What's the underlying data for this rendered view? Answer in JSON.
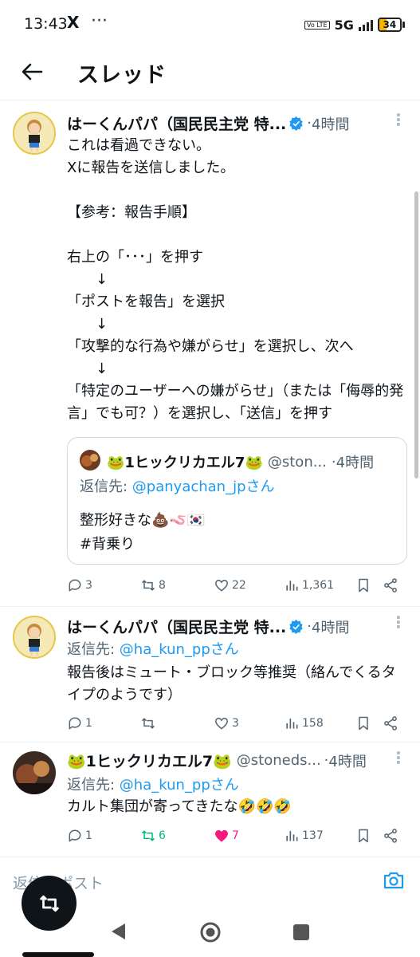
{
  "status_bar": {
    "time": "13:43",
    "x_icon": "X",
    "dots": "···",
    "volte": "Vo LTE",
    "network": "5G",
    "battery": "34",
    "battery_level": 0.34
  },
  "header": {
    "title": "スレッド"
  },
  "tweets": [
    {
      "name": "はーくんパパ（国民民主党 特...",
      "time": "4時間",
      "text": "これは看過できない。\nXに報告を送信しました。\n\n【参考：報告手順】\n\n右上の「･･･」を押す\n　　↓\n「ポストを報告」を選択\n　　↓\n「攻撃的な行為や嫌がらせ」を選択し、次へ\n　　↓\n「特定のユーザーへの嫌がらせ」（または「侮辱的発言」でも可？）を選択し、「送信」を押す",
      "quote": {
        "name": "🐸1ヒックリカエル7🐸",
        "handle": "@ston...",
        "time": "4時間",
        "reply_prefix": "返信先: ",
        "reply_to": "@panyachan_jpさん",
        "text": "整形好きな💩🪱🇰🇷\n#背乗り"
      },
      "stats": {
        "replies": "3",
        "retweets": "8",
        "likes": "22",
        "views": "1,361"
      }
    },
    {
      "name": "はーくんパパ（国民民主党 特...",
      "time": "4時間",
      "reply_prefix": "返信先: ",
      "reply_to": "@ha_kun_ppさん",
      "text": "報告後はミュート・ブロック等推奨（絡んでくるタイプのようです）",
      "stats": {
        "replies": "1",
        "retweets": "",
        "likes": "3",
        "views": "158"
      }
    },
    {
      "name": "🐸1ヒックリカエル7🐸",
      "handle": "@stoneds...",
      "time": "4時間",
      "reply_prefix": "返信先: ",
      "reply_to": "@ha_kun_ppさん",
      "text": "カルト集団が寄ってきたな🤣🤣🤣",
      "stats": {
        "replies": "1",
        "retweets": "6",
        "likes": "7",
        "views": "137"
      }
    }
  ],
  "composer": {
    "placeholder": "返信をポスト"
  },
  "icons": {
    "back": "arrow-left-icon",
    "verified": "verified-badge-icon",
    "reply": "reply-icon",
    "retweet": "retweet-icon",
    "like": "heart-icon",
    "views": "views-icon",
    "bookmark": "bookmark-icon",
    "share": "share-icon",
    "camera": "camera-icon"
  },
  "colors": {
    "accent": "#1d9bf0",
    "retweet_active": "#00ba7c",
    "like_active": "#f91880",
    "muted": "#536471"
  }
}
